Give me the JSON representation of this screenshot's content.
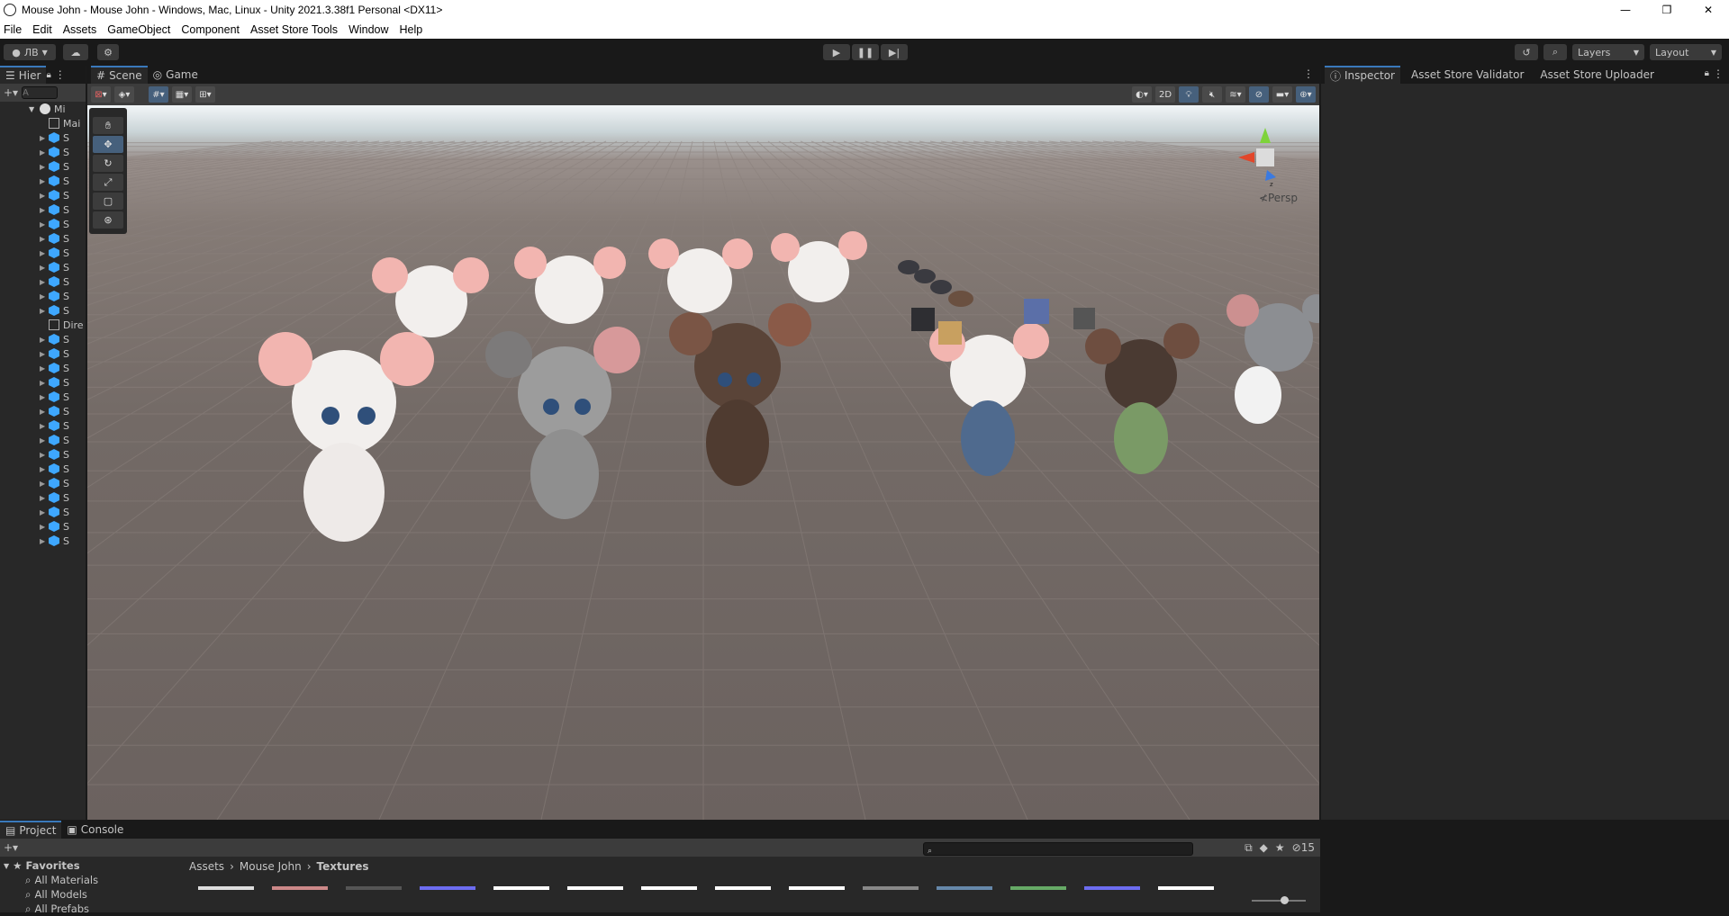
{
  "window": {
    "title": "Mouse John - Mouse John - Windows, Mac, Linux - Unity 2021.3.38f1 Personal <DX11>",
    "controls": [
      "—",
      "❐",
      "✕"
    ]
  },
  "menu": [
    "File",
    "Edit",
    "Assets",
    "GameObject",
    "Component",
    "Asset Store Tools",
    "Window",
    "Help"
  ],
  "toolbar": {
    "account_label": "ЛВ",
    "layers_label": "Layers",
    "layout_label": "Layout"
  },
  "hierarchy": {
    "tab_label": "Hier",
    "search_placeholder": "A",
    "scene_root": "Mi",
    "items": [
      {
        "type": "go",
        "label": "Mai"
      },
      {
        "type": "prefab",
        "label": "S"
      },
      {
        "type": "prefab",
        "label": "S"
      },
      {
        "type": "prefab",
        "label": "S"
      },
      {
        "type": "prefab",
        "label": "S"
      },
      {
        "type": "prefab",
        "label": "S"
      },
      {
        "type": "prefab",
        "label": "S"
      },
      {
        "type": "prefab",
        "label": "S"
      },
      {
        "type": "prefab",
        "label": "S"
      },
      {
        "type": "prefab",
        "label": "S"
      },
      {
        "type": "prefab",
        "label": "S"
      },
      {
        "type": "prefab",
        "label": "S"
      },
      {
        "type": "prefab",
        "label": "S"
      },
      {
        "type": "prefab",
        "label": "S"
      },
      {
        "type": "go",
        "label": "Dire"
      },
      {
        "type": "prefab",
        "label": "S"
      },
      {
        "type": "prefab",
        "label": "S"
      },
      {
        "type": "prefab",
        "label": "S"
      },
      {
        "type": "prefab",
        "label": "S"
      },
      {
        "type": "prefab",
        "label": "S"
      },
      {
        "type": "prefab",
        "label": "S"
      },
      {
        "type": "prefab",
        "label": "S"
      },
      {
        "type": "prefab",
        "label": "S"
      },
      {
        "type": "prefab",
        "label": "S"
      },
      {
        "type": "prefab",
        "label": "S"
      },
      {
        "type": "prefab",
        "label": "S"
      },
      {
        "type": "prefab",
        "label": "S"
      },
      {
        "type": "prefab",
        "label": "S"
      },
      {
        "type": "prefab",
        "label": "S"
      },
      {
        "type": "prefab",
        "label": "S"
      }
    ]
  },
  "scene": {
    "tabs": [
      "Scene",
      "Game"
    ],
    "mode_2d": "2D",
    "camera_label": "≮Persp"
  },
  "inspector": {
    "tabs": [
      "Inspector",
      "Asset Store Validator",
      "Asset Store Uploader"
    ]
  },
  "project": {
    "tabs": [
      "Project",
      "Console"
    ],
    "hidden_count": "15",
    "favorites_label": "Favorites",
    "favorites": [
      "All Materials",
      "All Models",
      "All Prefabs"
    ],
    "breadcrumb": [
      "Assets",
      "Mouse John",
      "Textures"
    ]
  },
  "colors": {
    "accent": "#3a79bb",
    "prefab": "#3ea7ff",
    "panel": "#282828",
    "chrome": "#191919"
  }
}
